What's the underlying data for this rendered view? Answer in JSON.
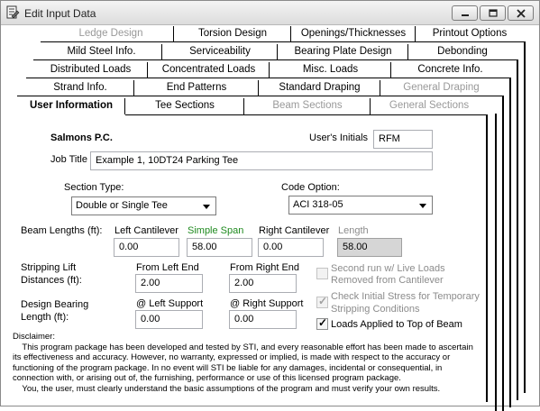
{
  "window": {
    "title": "Edit Input Data",
    "buttons": [
      "minimize",
      "restore",
      "close"
    ]
  },
  "tabs": {
    "row1": [
      {
        "label": "Ledge Design",
        "disabled": true
      },
      {
        "label": "Torsion Design",
        "disabled": false
      },
      {
        "label": "Openings/Thicknesses",
        "disabled": false
      },
      {
        "label": "Printout Options",
        "disabled": false
      }
    ],
    "row2": [
      {
        "label": "Mild Steel Info.",
        "disabled": false
      },
      {
        "label": "Serviceability",
        "disabled": false
      },
      {
        "label": "Bearing Plate Design",
        "disabled": false
      },
      {
        "label": "Debonding",
        "disabled": false
      }
    ],
    "row3": [
      {
        "label": "Distributed Loads",
        "disabled": false
      },
      {
        "label": "Concentrated Loads",
        "disabled": false
      },
      {
        "label": "Misc. Loads",
        "disabled": false
      },
      {
        "label": "Concrete Info.",
        "disabled": false
      }
    ],
    "row4": [
      {
        "label": "Strand Info.",
        "disabled": false
      },
      {
        "label": "End Patterns",
        "disabled": false
      },
      {
        "label": "Standard Draping",
        "disabled": false
      },
      {
        "label": "General Draping",
        "disabled": true
      }
    ],
    "row5": [
      {
        "label": "User Information",
        "disabled": false,
        "active": true
      },
      {
        "label": "Tee Sections",
        "disabled": false
      },
      {
        "label": "Beam Sections",
        "disabled": true
      },
      {
        "label": "General Sections",
        "disabled": true
      }
    ]
  },
  "form": {
    "company": "Salmons P.C.",
    "initials_label": "User's Initials",
    "initials_value": "RFM",
    "job_title_label": "Job Title",
    "job_title_value": "Example 1, 10DT24 Parking Tee",
    "section_type_label": "Section Type:",
    "section_type_value": "Double or Single Tee",
    "code_option_label": "Code Option:",
    "code_option_value": "ACI 318-05",
    "beam_lengths_label": "Beam Lengths (ft):",
    "left_cantilever_label": "Left Cantilever",
    "left_cantilever_value": "0.00",
    "simple_span_label": "Simple Span",
    "simple_span_value": "58.00",
    "right_cantilever_label": "Right Cantilever",
    "right_cantilever_value": "0.00",
    "length_label": "Length",
    "length_value": "58.00",
    "stripping_label_1": "Stripping Lift",
    "stripping_label_2": "Distances (ft):",
    "from_left_end_label": "From Left End",
    "from_left_end_value": "2.00",
    "from_right_end_label": "From Right End",
    "from_right_end_value": "2.00",
    "bearing_label_1": "Design Bearing",
    "bearing_label_2": "Length (ft):",
    "left_support_label": "@ Left Support",
    "left_support_value": "0.00",
    "right_support_label": "@ Right Support",
    "right_support_value": "0.00",
    "chk_second_run_1": "Second run w/ Live Loads",
    "chk_second_run_2": "Removed from Cantilever",
    "chk_second_run_checked": false,
    "chk_initial_stress_1": "Check Initial Stress for Temporary",
    "chk_initial_stress_2": "Stripping Conditions",
    "chk_initial_stress_checked": true,
    "chk_loads_top": "Loads Applied to Top of Beam",
    "chk_loads_top_checked": true
  },
  "disclaimer": {
    "heading": "Disclaimer:",
    "lines": [
      "    This program package has been developed and tested by STI, and every reasonable effort has been made to ascertain",
      "its effectiveness and accuracy. However, no warranty, expressed or implied, is made with respect to the accuracy or",
      "functioning of the program package. In no event will STI be liable for any damages, incidental or consequential, in",
      "connection with, or arising out of, the furnishing, performance or use of this licensed program package.",
      "    You, the user, must clearly understand the basic assumptions of the program and must verify your own results."
    ]
  },
  "colors": {
    "simple_span_label": "#1f8a1f",
    "disabled_text": "#999999"
  }
}
